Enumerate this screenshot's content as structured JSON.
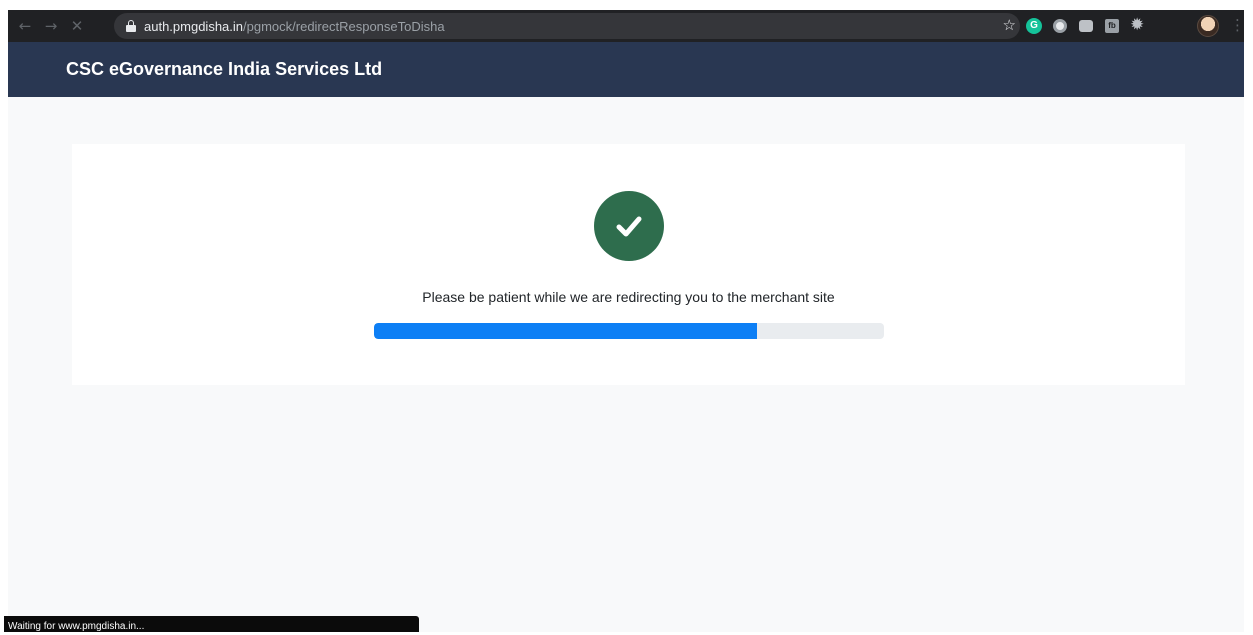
{
  "browser": {
    "url_host": "auth.pmgdisha.in",
    "url_path": "/pgmock/redirectResponseToDisha",
    "back_icon": "←",
    "forward_icon": "→",
    "stop_icon": "✕",
    "star_icon": "☆",
    "menu_icon": "⋮",
    "extensions": [
      "grammarly-icon",
      "circle-extension-icon",
      "camera-extension-icon",
      "fb-extension-icon",
      "gear-extension-icon"
    ],
    "grammarly_letter": "G",
    "fb_label": "fb"
  },
  "header": {
    "brand": "CSC eGovernance India Services Ltd"
  },
  "main": {
    "message": "Please be patient while we are redirecting you to the merchant site",
    "progress_fraction": 0.75,
    "check_color": "#2e6d4d",
    "progress_color": "#0d7ff5"
  },
  "status": {
    "text": "Waiting for www.pmgdisha.in..."
  }
}
